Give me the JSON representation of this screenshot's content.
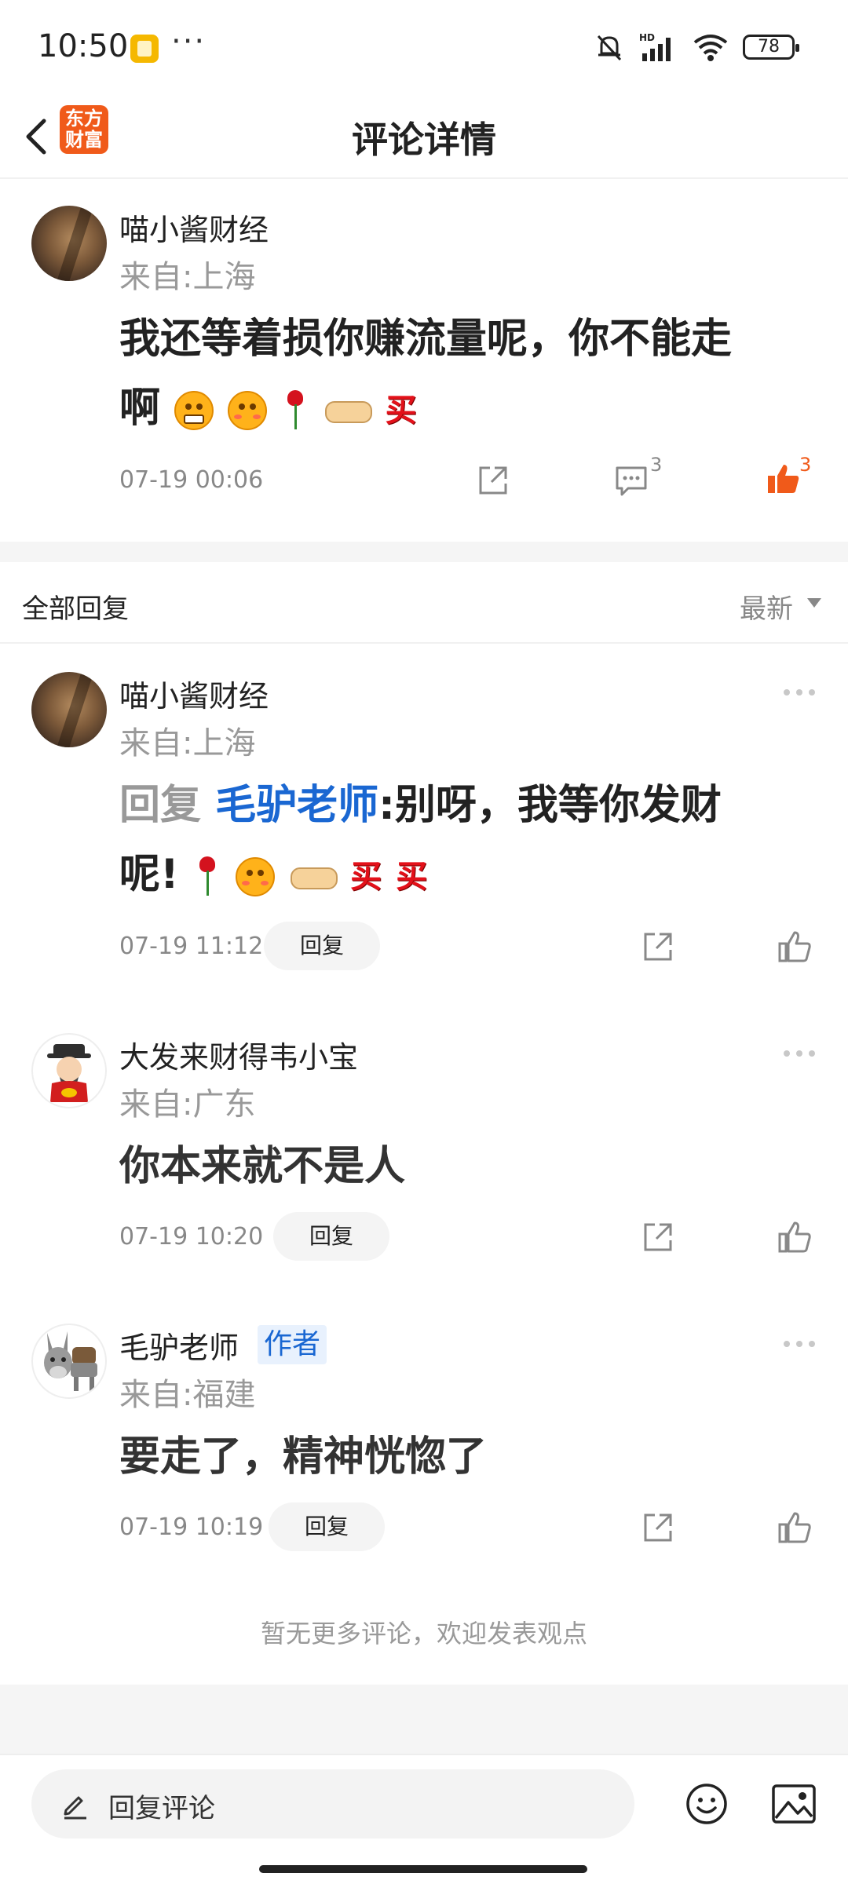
{
  "status_bar": {
    "time": "10:50",
    "dots": "···",
    "battery": "78"
  },
  "header": {
    "title": "评论详情",
    "logo_line1": "东方",
    "logo_line2": "财富"
  },
  "main_comment": {
    "username": "喵小酱财经",
    "location": "来自:上海",
    "text_line1": "我还等着损你赚流量呢，你不能走",
    "text_line2": "啊",
    "time": "07-19 00:06",
    "comment_count": "3",
    "like_count": "3",
    "buy_emoji": "买"
  },
  "replies_header": {
    "title": "全部回复",
    "sort": "最新"
  },
  "replies": [
    {
      "username": "喵小酱财经",
      "location": "来自:上海",
      "reply_prefix": "回复",
      "reply_target": "毛驴老师",
      "text_line1_rest": ":别呀，我等你发财",
      "text_line2": "呢!",
      "buy_emoji": "买",
      "time": "07-19 11:12",
      "reply_label": "回复"
    },
    {
      "username": "大发来财得韦小宝",
      "location": "来自:广东",
      "text": "你本来就不是人",
      "time": "07-19 10:20",
      "reply_label": "回复"
    },
    {
      "username": "毛驴老师",
      "badge": "作者",
      "location": "来自:福建",
      "text": "要走了，精神恍惚了",
      "time": "07-19 10:19",
      "reply_label": "回复"
    }
  ],
  "footer_note": "暂无更多评论，欢迎发表观点",
  "bottom_bar": {
    "input_placeholder": "回复评论"
  },
  "colors": {
    "accent_orange": "#f05a1a",
    "link_blue": "#1a67d2",
    "muted": "#999999"
  }
}
